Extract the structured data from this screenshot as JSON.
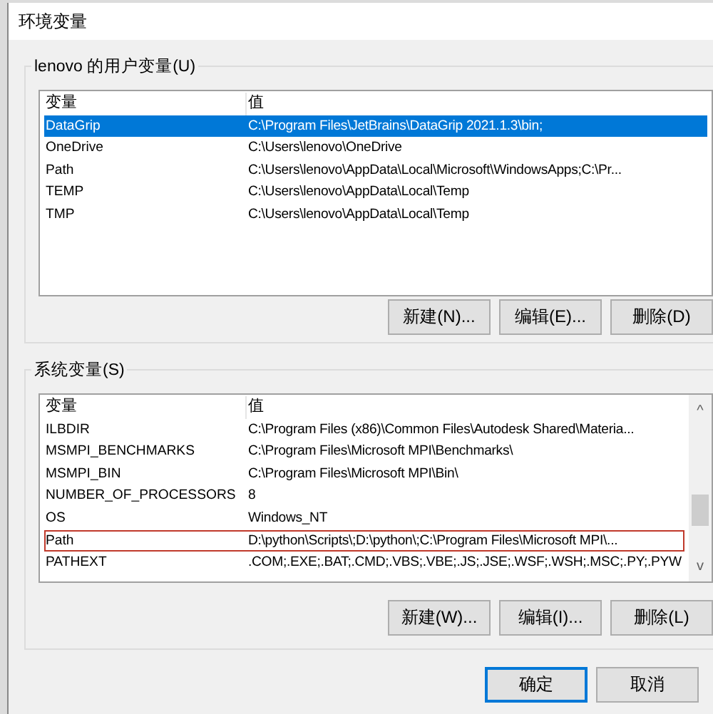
{
  "window": {
    "title": "环境变量"
  },
  "user_variables": {
    "label": "lenovo 的用户变量(U)",
    "columns": [
      "变量",
      "值"
    ],
    "rows": [
      {
        "name": "DataGrip",
        "value": "C:\\Program Files\\JetBrains\\DataGrip 2021.1.3\\bin;",
        "selected": true
      },
      {
        "name": "OneDrive",
        "value": "C:\\Users\\lenovo\\OneDrive",
        "selected": false
      },
      {
        "name": "Path",
        "value": "C:\\Users\\lenovo\\AppData\\Local\\Microsoft\\WindowsApps;C:\\Pr...",
        "selected": false
      },
      {
        "name": "TEMP",
        "value": "C:\\Users\\lenovo\\AppData\\Local\\Temp",
        "selected": false
      },
      {
        "name": "TMP",
        "value": "C:\\Users\\lenovo\\AppData\\Local\\Temp",
        "selected": false
      }
    ],
    "buttons": [
      "新建(N)...",
      "编辑(E)...",
      "删除(D)"
    ]
  },
  "system_variables": {
    "label": "系统变量(S)",
    "columns": [
      "变量",
      "值"
    ],
    "rows": [
      {
        "name": "ILBDIR",
        "value": "C:\\Program Files (x86)\\Common Files\\Autodesk Shared\\Materia...",
        "selected": false,
        "outlined": false
      },
      {
        "name": "MSMPI_BENCHMARKS",
        "value": "C:\\Program Files\\Microsoft MPI\\Benchmarks\\",
        "selected": false,
        "outlined": false
      },
      {
        "name": "MSMPI_BIN",
        "value": "C:\\Program Files\\Microsoft MPI\\Bin\\",
        "selected": false,
        "outlined": false
      },
      {
        "name": "NUMBER_OF_PROCESSORS",
        "value": "8",
        "selected": false,
        "outlined": false
      },
      {
        "name": "OS",
        "value": "Windows_NT",
        "selected": false,
        "outlined": false
      },
      {
        "name": "Path",
        "value": "D:\\python\\Scripts\\;D:\\python\\;C:\\Program Files\\Microsoft MPI\\...",
        "selected": false,
        "outlined": true
      },
      {
        "name": "PATHEXT",
        "value": ".COM;.EXE;.BAT;.CMD;.VBS;.VBE;.JS;.JSE;.WSF;.WSH;.MSC;.PY;.PYW",
        "selected": false,
        "outlined": false
      }
    ],
    "scrollbar": {
      "up_arrow": "^",
      "down_arrow": "v"
    },
    "buttons": [
      "新建(W)...",
      "编辑(I)...",
      "删除(L)"
    ]
  },
  "dialog_buttons": [
    {
      "label": "确定",
      "default": true
    },
    {
      "label": "取消",
      "default": false
    }
  ]
}
